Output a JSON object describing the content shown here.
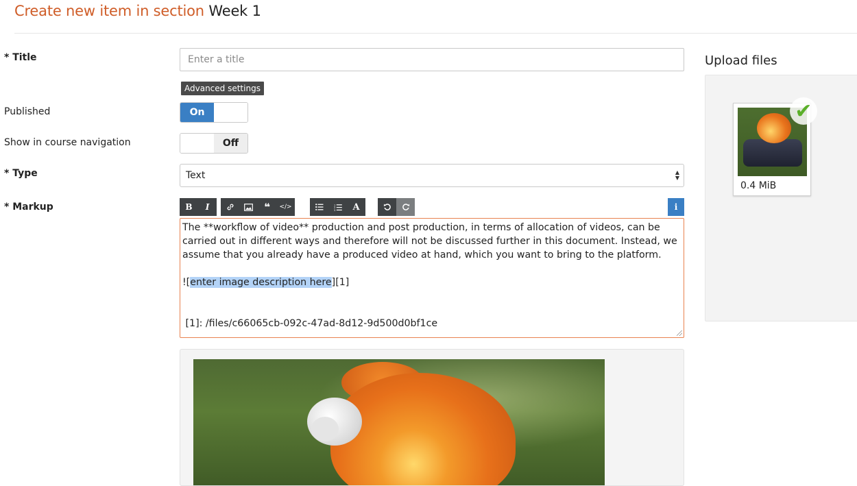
{
  "header": {
    "title_prefix": "Create new item in section",
    "section_name": "Week 1"
  },
  "form": {
    "title": {
      "label": "* Title",
      "placeholder": "Enter a title",
      "value": ""
    },
    "advanced_settings_label": "Advanced settings",
    "published": {
      "label": "Published",
      "state": "On"
    },
    "show_in_nav": {
      "label": "Show in course navigation",
      "state": "Off"
    },
    "type": {
      "label": "* Type",
      "selected": "Text"
    },
    "markup": {
      "label": "* Markup",
      "toolbar": {
        "format": [
          "bold",
          "italic"
        ],
        "insert": [
          "link",
          "image",
          "quote",
          "code"
        ],
        "lists": [
          "bulleted-list",
          "numbered-list",
          "heading"
        ],
        "history": [
          "undo",
          "redo"
        ],
        "help": "info"
      },
      "line1": "The **workflow of video** production and post production, in terms of allocation of videos, can be carried out in different ways and therefore will not be discussed further in this document. Instead, we assume that you already have a produced video at hand, which you want to bring to the platform.",
      "image_prefix": "![",
      "image_desc": "enter image description here",
      "image_suffix": "][1]",
      "ref_line": " [1]: /files/c66065cb-092c-47ad-8d12-9d500d0bf1ce"
    }
  },
  "upload": {
    "title": "Upload files",
    "files": [
      {
        "size": "0.4 MiB",
        "status": "uploaded"
      }
    ]
  },
  "colors": {
    "accent": "#cf5d28",
    "toggle_on": "#3a7fc4",
    "toolbar": "#3f4244",
    "editor_border": "#e8824f",
    "selection": "#b3d3f7",
    "check": "#5bb02a"
  }
}
